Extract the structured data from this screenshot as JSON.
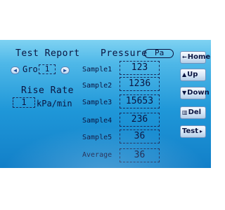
{
  "report": {
    "title": "Test Report",
    "group_label": "Gro",
    "group_value": "1",
    "rise_rate_label": "Rise Rate",
    "rise_rate_value": "1",
    "rise_rate_unit": "kPa/min"
  },
  "pressure": {
    "label": "Pressure",
    "unit": "Pa"
  },
  "samples": [
    {
      "label": "Sample1",
      "value": "123"
    },
    {
      "label": "Sample2",
      "value": "1236"
    },
    {
      "label": "Sample3",
      "value": "15653"
    },
    {
      "label": "Sample4",
      "value": "236"
    },
    {
      "label": "Sample5",
      "value": "36"
    }
  ],
  "average": {
    "label": "Average",
    "value": "36"
  },
  "buttons": {
    "home": "Home",
    "up": "Up",
    "down": "Down",
    "del": "Del",
    "test": "Test"
  },
  "colors": {
    "screen_top": "#7fd2f2",
    "screen_bottom": "#127fc8",
    "text": "#0a1440"
  },
  "icons": {
    "prev": "chevron-left-icon",
    "next": "chevron-right-icon",
    "home": "home-arrow-icon",
    "up": "up-arrow-icon",
    "down": "down-arrow-icon",
    "del": "trash-icon",
    "test": "dropdown-arrow-icon"
  }
}
